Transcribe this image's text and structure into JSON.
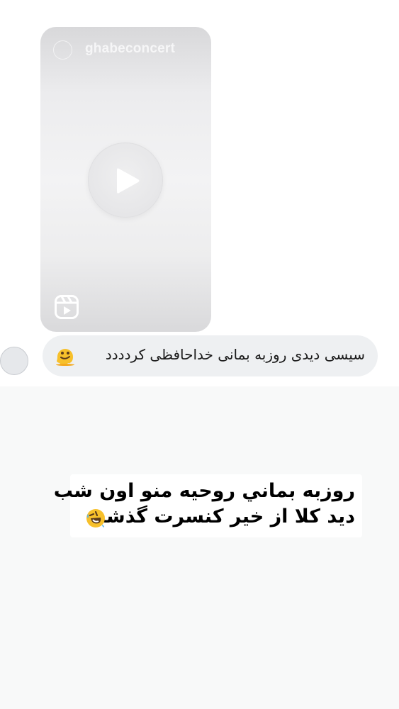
{
  "reel": {
    "username": "ghabeconcert",
    "play_icon": "play-icon",
    "reels_icon": "reels-icon"
  },
  "message": {
    "text": "سیسی دیدی روزبه بمانی خداحافظی کردددد",
    "emoji": "melting-face-emoji"
  },
  "caption": {
    "line1": "روزبه بماني روحيه منو اون شب",
    "line2": "ديد كلا از خير كنسرت گذشت",
    "emoji": "rolling-on-the-floor-laughing-emoji"
  },
  "colors": {
    "bubble": "#eef0f2",
    "bottom_background": "#f8f9f9",
    "caption_background": "#ffffff"
  }
}
